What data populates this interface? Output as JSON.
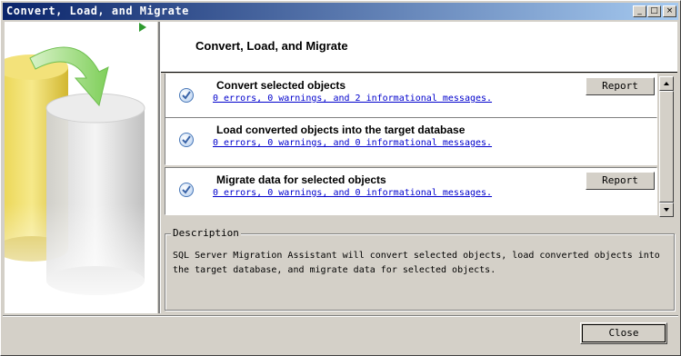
{
  "window": {
    "title": "Convert, Load, and Migrate",
    "controls": {
      "minimize": "_",
      "maximize": "□",
      "close": "×"
    }
  },
  "header": {
    "title": "Convert, Load, and Migrate"
  },
  "steps": [
    {
      "title": "Convert selected objects",
      "link": "0 errors, 0 warnings, and 2 informational messages.",
      "button": "Report",
      "status_icon": "check-circle-icon"
    },
    {
      "title": "Load converted objects into the target database",
      "link": "0 errors, 0 warnings, and 0 informational messages.",
      "status_icon": "check-circle-icon"
    },
    {
      "title": "Migrate data for selected objects",
      "link": "0 errors, 0 warnings, and 0 informational messages.",
      "button": "Report",
      "status_icon": "check-circle-icon"
    }
  ],
  "description": {
    "label": "Description",
    "text": "SQL Server Migration Assistant will convert selected objects, load converted objects into the target database, and migrate data for selected objects."
  },
  "footer": {
    "close_label": "Close"
  },
  "colors": {
    "titlebar_start": "#0a246a",
    "titlebar_end": "#a6caf0",
    "link": "#0000cc",
    "check_accent": "#4a78b8",
    "arrow": "#2e9a2e"
  }
}
